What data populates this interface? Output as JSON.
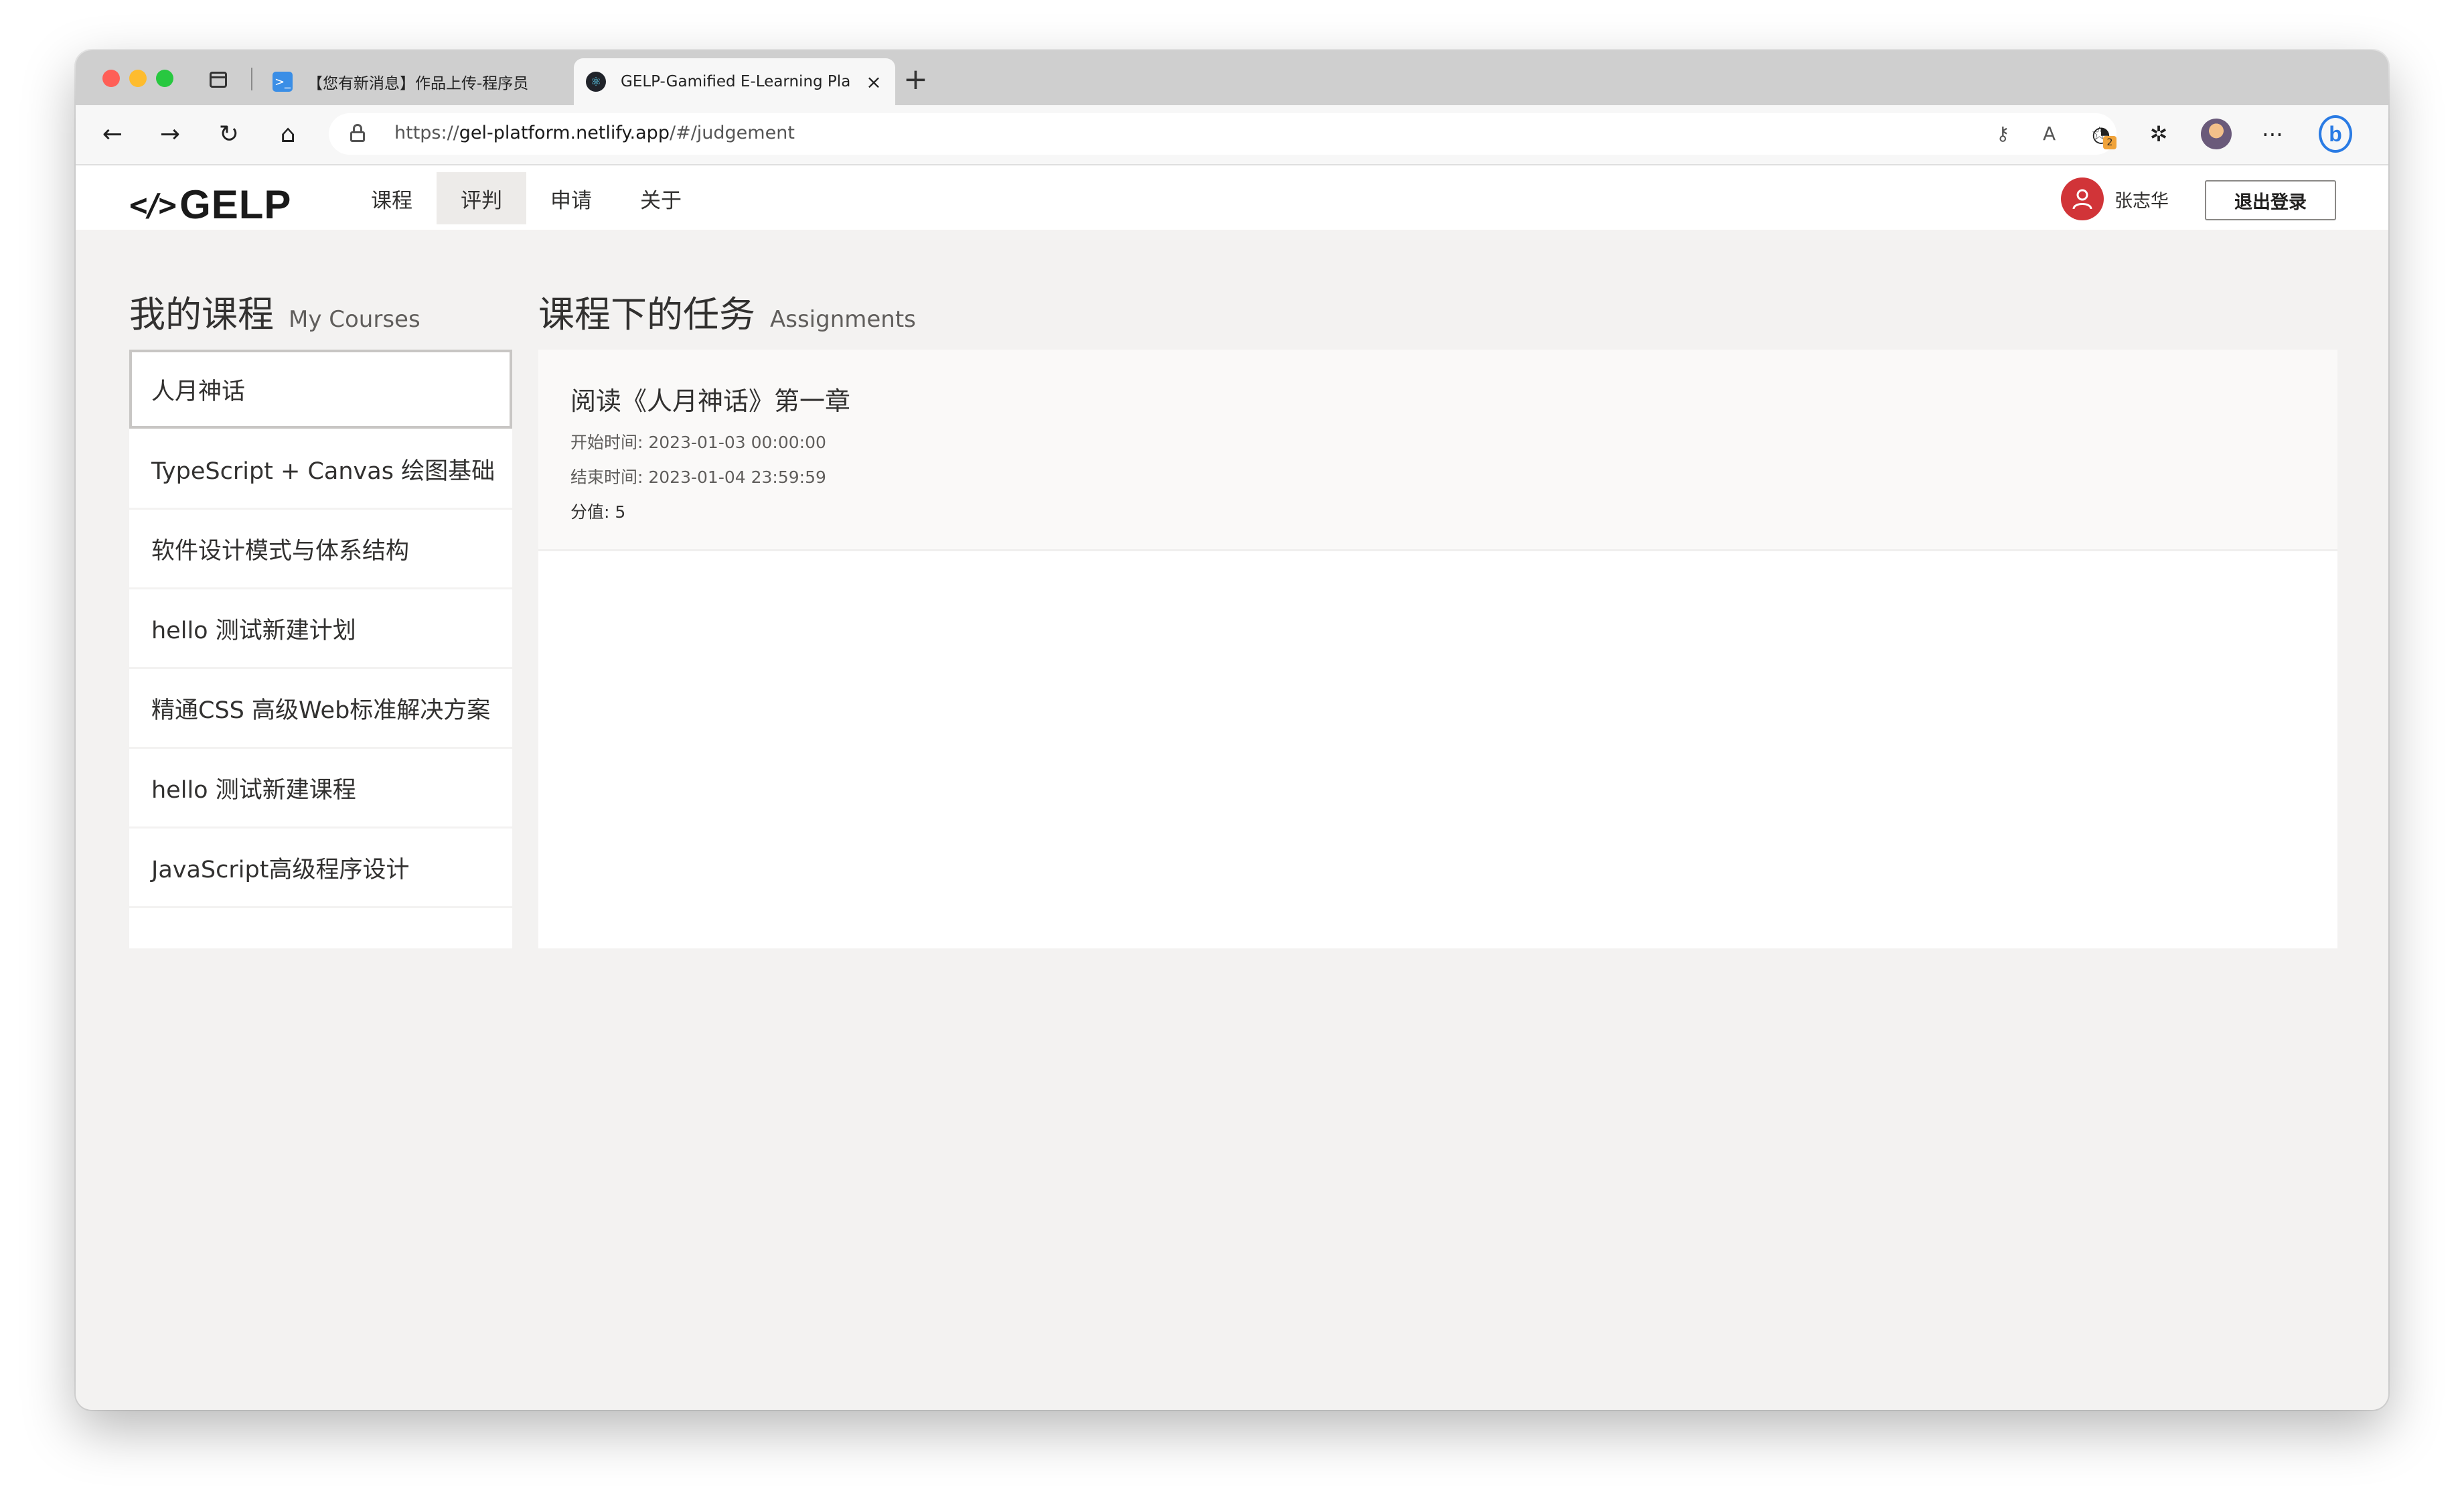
{
  "browser": {
    "tabs": [
      {
        "title": "【您有新消息】作品上传-程序员",
        "close": "×"
      },
      {
        "title": "GELP-Gamified E-Learning Pla",
        "close": "×"
      }
    ],
    "new_tab": "+",
    "url_prefix": "https://",
    "url_host": "gel-platform.netlify.app",
    "url_path": "/#/judgement",
    "extension_badge": "2",
    "bing_label": "b"
  },
  "app": {
    "logo_mark": "</>",
    "logo_text": "GELP",
    "nav": [
      {
        "label": "课程"
      },
      {
        "label": "评判",
        "active": true
      },
      {
        "label": "申请"
      },
      {
        "label": "关于"
      }
    ],
    "user_name": "张志华",
    "logout_label": "退出登录"
  },
  "courses_heading": {
    "zh": "我的课程",
    "en": "My Courses"
  },
  "courses": [
    "人月神话",
    "TypeScript + Canvas 绘图基础",
    "软件设计模式与体系结构",
    "hello 测试新建计划",
    "精通CSS 高级Web标准解决方案",
    "hello 测试新建课程",
    "JavaScript高级程序设计"
  ],
  "selected_course": "人月神话",
  "tasks_heading": {
    "zh": "课程下的任务",
    "en": "Assignments"
  },
  "tasks": [
    {
      "title": "阅读《人月神话》第一章",
      "start": "开始时间: 2023-01-03 00:00:00",
      "end": "结束时间: 2023-01-04 23:59:59",
      "score": "分值: 5"
    }
  ],
  "colors": {
    "page_bg": "#f3f2f1",
    "avatar_red": "#d13438",
    "nav_active_bg": "#edebe9"
  }
}
